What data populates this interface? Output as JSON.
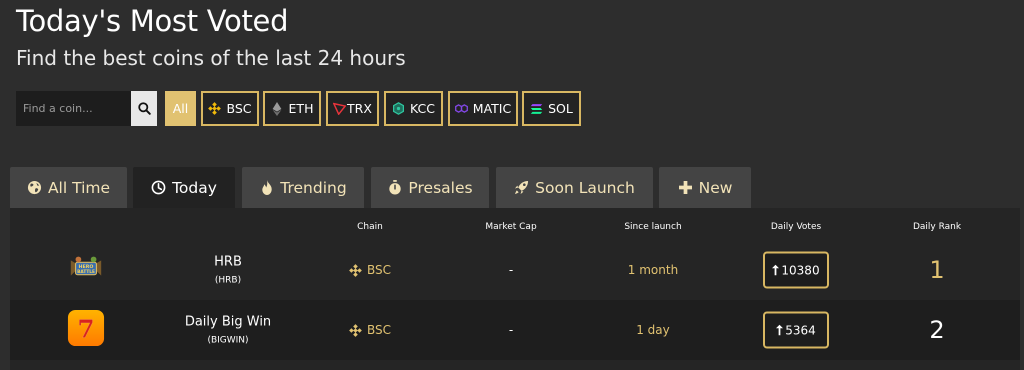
{
  "header": {
    "title": "Today's Most Voted",
    "subtitle": "Find the best coins of the last 24 hours"
  },
  "search": {
    "placeholder": "Find a coin..."
  },
  "chains": [
    {
      "label": "All",
      "active": true
    },
    {
      "label": "BSC",
      "icon": "bnb-icon",
      "color": "#f0b90b"
    },
    {
      "label": "ETH",
      "icon": "ethereum-icon",
      "color": "#a9a9a9"
    },
    {
      "label": "TRX",
      "icon": "tron-icon",
      "color": "#e8343b"
    },
    {
      "label": "KCC",
      "icon": "kcc-icon",
      "color": "#2fc8a1"
    },
    {
      "label": "MATIC",
      "icon": "polygon-icon",
      "color": "#8247e5"
    },
    {
      "label": "SOL",
      "icon": "solana-icon",
      "color": "#14f195"
    }
  ],
  "tabs": [
    {
      "label": "All Time",
      "icon": "globe-icon"
    },
    {
      "label": "Today",
      "icon": "clock-icon",
      "active": true
    },
    {
      "label": "Trending",
      "icon": "fire-icon"
    },
    {
      "label": "Presales",
      "icon": "stopwatch-icon"
    },
    {
      "label": "Soon Launch",
      "icon": "rocket-icon"
    },
    {
      "label": "New",
      "icon": "plus-icon"
    }
  ],
  "table": {
    "columns": [
      "Chain",
      "Market Cap",
      "Since launch",
      "Daily Votes",
      "Daily Rank"
    ],
    "rows": [
      {
        "name": "HRB",
        "symbol": "(HRB)",
        "chain": "BSC",
        "market_cap": "-",
        "since_launch": "1 month",
        "votes": "10380",
        "rank": "1",
        "logo": "hero-battle-logo"
      },
      {
        "name": "Daily Big Win",
        "symbol": "(BIGWIN)",
        "chain": "BSC",
        "market_cap": "-",
        "since_launch": "1 day",
        "votes": "5364",
        "rank": "2",
        "logo": "big-win-777-logo"
      }
    ]
  },
  "colors": {
    "accent": "#e1c271",
    "background": "#2d2d2d"
  }
}
